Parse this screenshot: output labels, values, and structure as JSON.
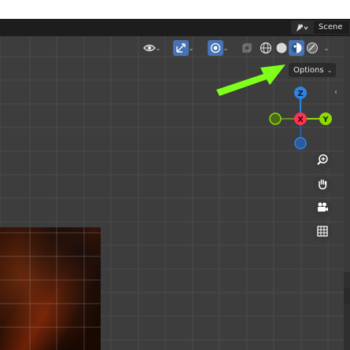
{
  "scene_selector": {
    "icon": "scene-icon",
    "label": "Scene"
  },
  "header": {
    "visibility": {
      "icon": "eye-visibility-icon"
    },
    "gizmo_toggle": {
      "icon": "gizmo-arrows-icon"
    },
    "overlays": {
      "icon": "overlays-icon"
    },
    "xray": {
      "icon": "xray-icon"
    },
    "shading": {
      "wireframe": {
        "icon": "wireframe-shading-icon"
      },
      "solid": {
        "icon": "solid-shading-icon"
      },
      "material_preview": {
        "icon": "material-preview-icon",
        "active": true
      },
      "rendered": {
        "icon": "rendered-shading-icon"
      }
    }
  },
  "options": {
    "label": "Options"
  },
  "axis_gizmo": {
    "z_label": "Z",
    "x_label": "X",
    "y_label": "Y"
  },
  "navigation": [
    "zoom-icon",
    "pan-hand-icon",
    "camera-icon",
    "ortho-grid-icon"
  ],
  "colors": {
    "accent": "#4772b3",
    "annotation_arrow": "#7fff1a",
    "x_axis": "#ff3352",
    "y_axis": "#8bdc00",
    "z_axis": "#2f83e3"
  }
}
